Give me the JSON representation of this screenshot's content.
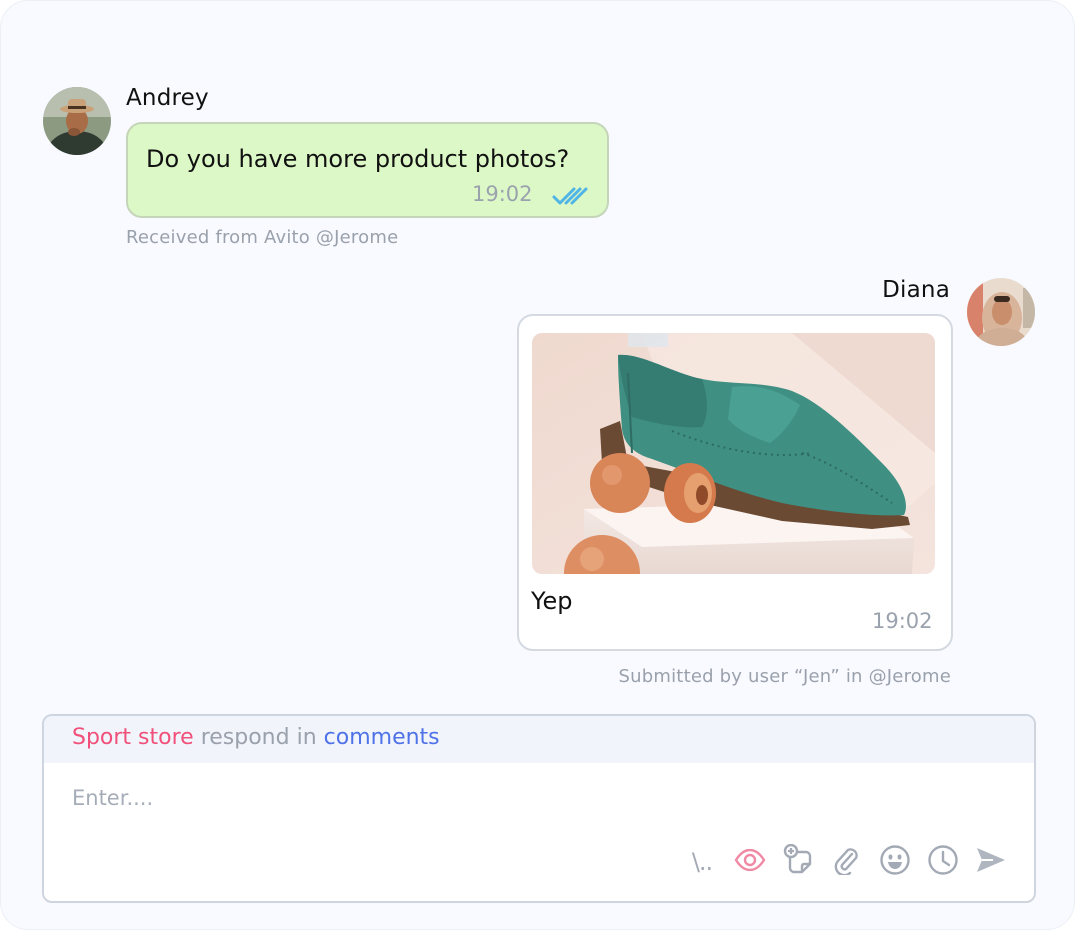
{
  "messages": {
    "incoming": {
      "sender": "Andrey",
      "text": "Do you have more product photos?",
      "time": "19:02",
      "status_icon": "double-check-icon",
      "source_note": "Received from Avito @Jerome"
    },
    "outgoing": {
      "sender": "Diana",
      "text": "Yep",
      "time": "19:02",
      "attachment": "shoe-photo",
      "source_note": "Submitted by user “Jen” in @Jerome"
    }
  },
  "composer": {
    "channel": "Sport store",
    "respond_text": "respond in",
    "target": "comments",
    "placeholder": "Enter....",
    "toolbar": {
      "templates_glyph": "\\..",
      "icons": [
        "templates-icon",
        "eye-icon",
        "sticker-icon",
        "paperclip-icon",
        "emoji-icon",
        "clock-icon",
        "send-icon"
      ]
    }
  },
  "colors": {
    "incoming_bubble": "#dcf8c6",
    "accent_pink": "#f0507a",
    "accent_blue": "#4f72e8",
    "check_blue": "#4fb5e6",
    "muted": "#9aa1ac"
  }
}
